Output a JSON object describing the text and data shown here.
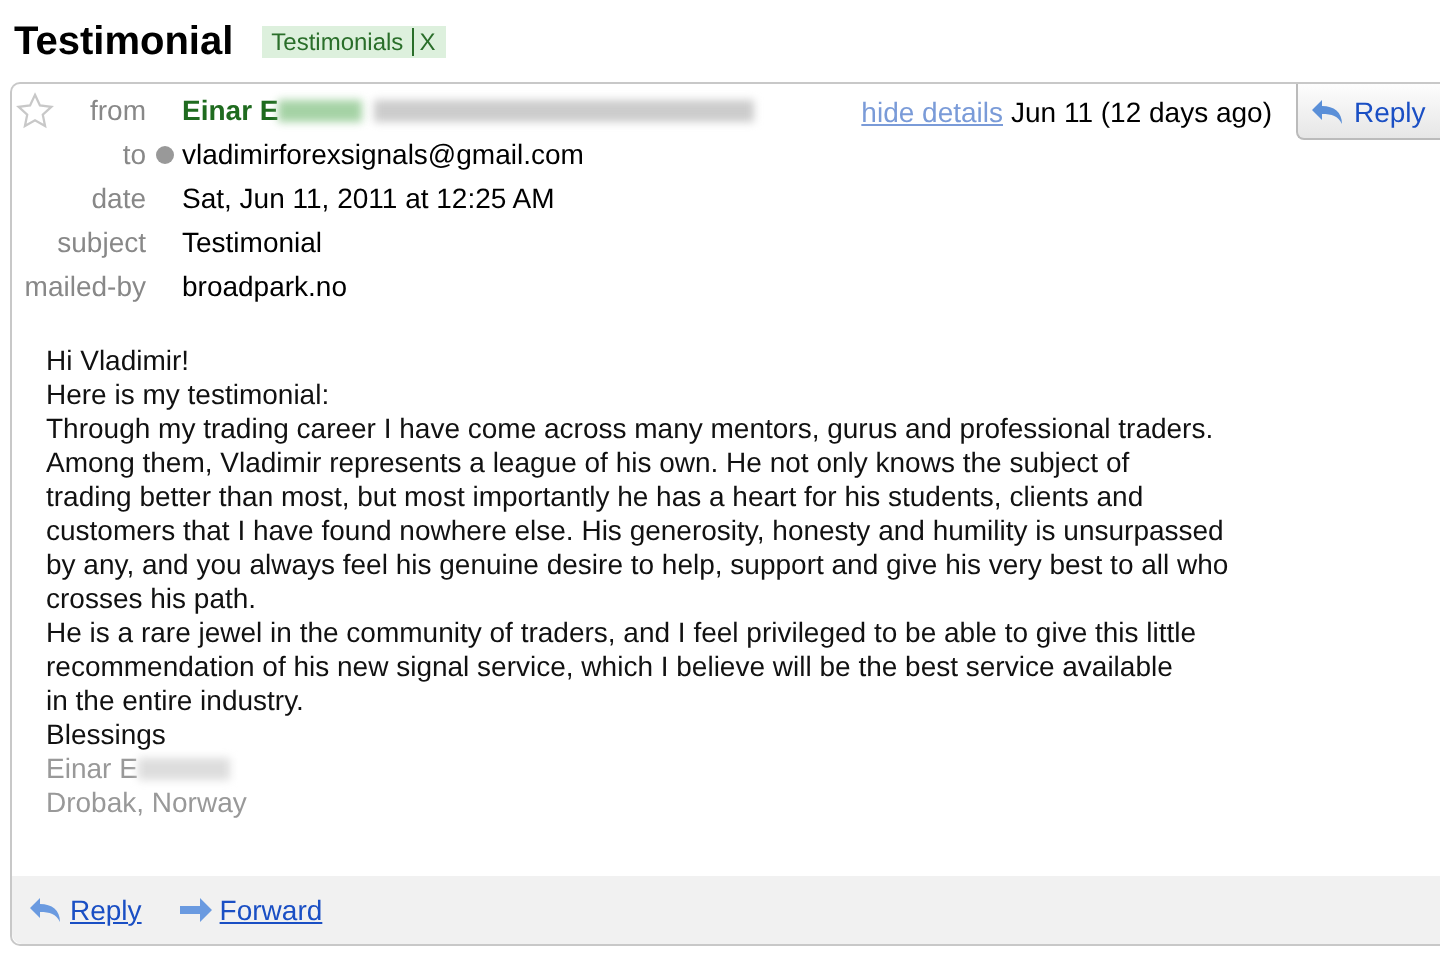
{
  "title": "Testimonial",
  "label": {
    "name": "Testimonials",
    "remove": "X"
  },
  "header": {
    "starred": false,
    "from_name": "Einar E",
    "hide_details": "hide details",
    "date_short": "Jun 11 (12 days ago)",
    "reply": "Reply",
    "fields": [
      {
        "label": "from"
      },
      {
        "label": "to",
        "value": "vladimirforexsignals@gmail.com"
      },
      {
        "label": "date",
        "value": "Sat, Jun 11, 2011 at 12:25 AM"
      },
      {
        "label": "subject",
        "value": "Testimonial"
      },
      {
        "label": "mailed-by",
        "value": "broadpark.no"
      }
    ]
  },
  "body": [
    {
      "text": "Hi Vladimir!",
      "kind": "text"
    },
    {
      "text": "Here is my testimonial:",
      "kind": "text"
    },
    {
      "text": "Through my trading career I have come across many mentors, gurus and professional traders.",
      "kind": "text"
    },
    {
      "text": "Among them, Vladimir represents a league of his own. He not only knows the subject of",
      "kind": "text"
    },
    {
      "text": "trading better than most, but most importantly he has a heart for his students, clients and",
      "kind": "text"
    },
    {
      "text": "customers that I have found nowhere else. His generosity, honesty and humility is unsurpassed",
      "kind": "text"
    },
    {
      "text": "by any, and you always feel his genuine desire to help, support and give his very best to all who",
      "kind": "text"
    },
    {
      "text": "crosses his path.",
      "kind": "text"
    },
    {
      "text": "He is a rare jewel in the community of traders, and I feel privileged to be able to give this little",
      "kind": "text"
    },
    {
      "text": "recommendation of his new signal service, which I believe will be the best service available",
      "kind": "text"
    },
    {
      "text": "in the entire industry.",
      "kind": "text"
    },
    {
      "text": "Blessings",
      "kind": "text"
    },
    {
      "text": "Einar E",
      "kind": "signature-redacted"
    },
    {
      "text": "Drobak, Norway",
      "kind": "signature"
    }
  ],
  "footer": {
    "reply": "Reply",
    "forward": "Forward"
  }
}
